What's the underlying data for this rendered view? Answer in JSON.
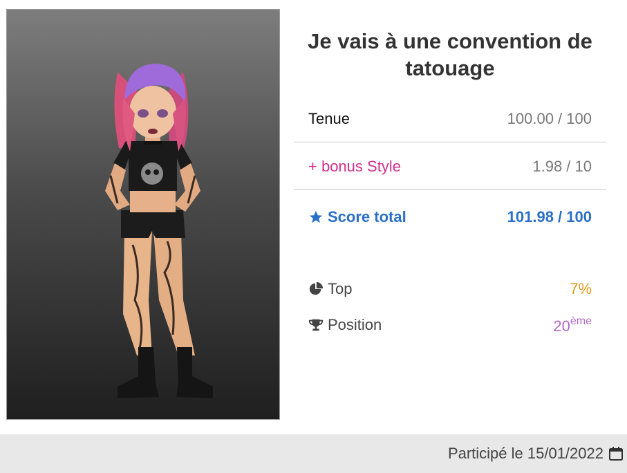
{
  "contest": {
    "title": "Je vais à une convention de tatouage"
  },
  "scores": {
    "tenue_label": "Tenue",
    "tenue_value": "100.00 / 100",
    "bonus_label": "+ bonus Style",
    "bonus_value": "1.98 / 10",
    "total_label": "Score total",
    "total_value": "101.98 / 100"
  },
  "stats": {
    "top_label": "Top",
    "top_value": "7%",
    "position_label": "Position",
    "position_value": "20",
    "position_suffix": "ème"
  },
  "footer": {
    "participation_text": "Participé le 15/01/2022"
  },
  "icons": {
    "score": "star-icon",
    "top": "pie-chart-icon",
    "position": "trophy-icon",
    "date": "calendar-icon"
  },
  "colors": {
    "score": "#2a6fc8",
    "bonus": "#d12f8f",
    "top": "#e09a1c",
    "position": "#b16ac9"
  }
}
